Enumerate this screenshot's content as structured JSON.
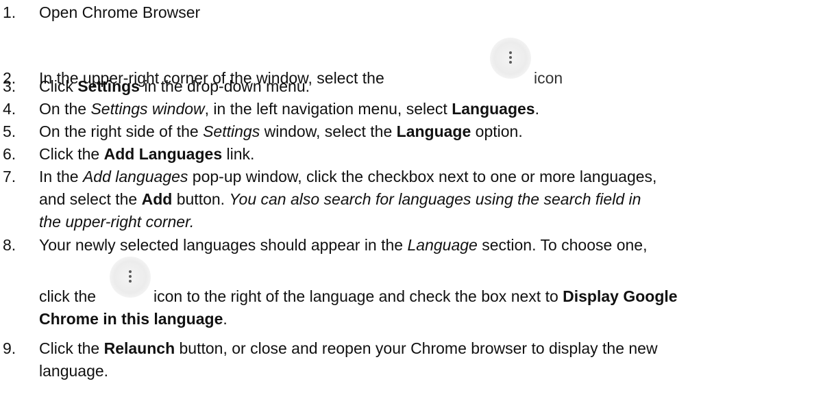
{
  "icons": {
    "menu_icon": "more-vertical-icon"
  },
  "steps": [
    {
      "num": "1.",
      "parts": [
        "Open Chrome Browser"
      ]
    },
    {
      "num": "2.",
      "parts": [
        "In the upper-right corner of the window, select the",
        "icon"
      ]
    },
    {
      "num": "3.",
      "parts": [
        "Click ",
        "Settings",
        " in the drop-down menu."
      ]
    },
    {
      "num": "4.",
      "parts": [
        "On the ",
        "Settings window",
        ", in the left navigation menu, select ",
        "Languages",
        "."
      ]
    },
    {
      "num": "5.",
      "parts": [
        "On the right side of the ",
        "Settings",
        " window, select the ",
        "Language",
        " option."
      ]
    },
    {
      "num": "6.",
      "parts": [
        "Click the ",
        "Add Languages",
        " link."
      ]
    },
    {
      "num": "7.",
      "parts": [
        "In the ",
        "Add languages",
        " pop-up window, click the checkbox next to one or more languages,",
        "and select the ",
        "Add",
        " button. ",
        "You can also search for languages using the search field in",
        "the upper-right corner."
      ]
    },
    {
      "num": "8.",
      "parts": [
        "Your newly selected languages should appear in the ",
        "Language",
        " section. To choose one,",
        "click the",
        "icon to the right of the language and check the box next to ",
        "Display Google",
        "Chrome in this language",
        "."
      ]
    },
    {
      "num": "9.",
      "parts": [
        "Click the ",
        "Relaunch",
        " button, or close and reopen your Chrome browser to display the new",
        "language."
      ]
    }
  ]
}
